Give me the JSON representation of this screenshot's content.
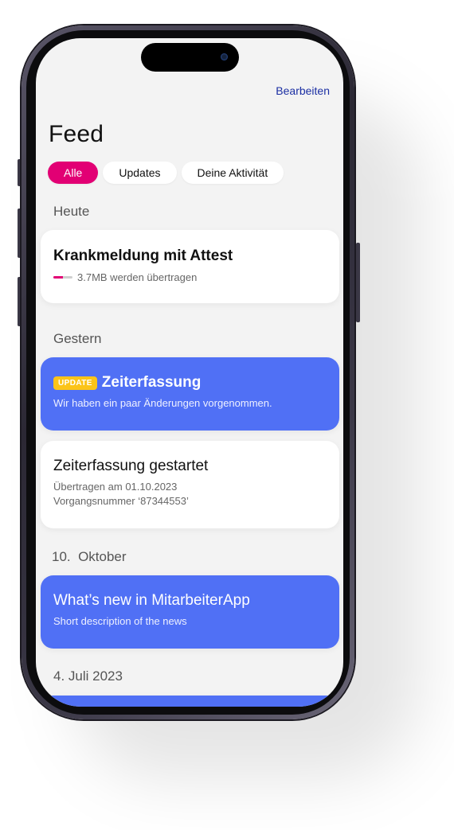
{
  "header": {
    "edit_label": "Bearbeiten",
    "title": "Feed"
  },
  "filters": [
    {
      "label": "Alle",
      "active": true
    },
    {
      "label": "Updates",
      "active": false
    },
    {
      "label": "Deine Aktivität",
      "active": false
    }
  ],
  "sections": {
    "today": "Heute",
    "yesterday": "Gestern",
    "oct10": "10.  Oktober",
    "jul4": "4. Juli 2023"
  },
  "cards": {
    "sick_note": {
      "title": "Krankmeldung mit Attest",
      "status": "3.7MB werden übertragen",
      "progress": 0.5
    },
    "update": {
      "badge": "UPDATE",
      "title": "Zeiterfassung",
      "description": "Wir haben ein paar Änderungen vorgenommen."
    },
    "time_tracking": {
      "title": "Zeiterfassung gestartet",
      "line1": "Übertragen am 01.10.2023",
      "line2": "Vorgangsnummer ‘87344553’"
    },
    "news": {
      "title": "What’s new in MitarbeiterApp",
      "description": "Short description of the news"
    }
  },
  "colors": {
    "accent": "#e20074",
    "card_blue": "#5070f5",
    "badge_yellow": "#fbc419",
    "link_blue": "#1b2fa3",
    "screen_bg": "#f3f3f3"
  }
}
